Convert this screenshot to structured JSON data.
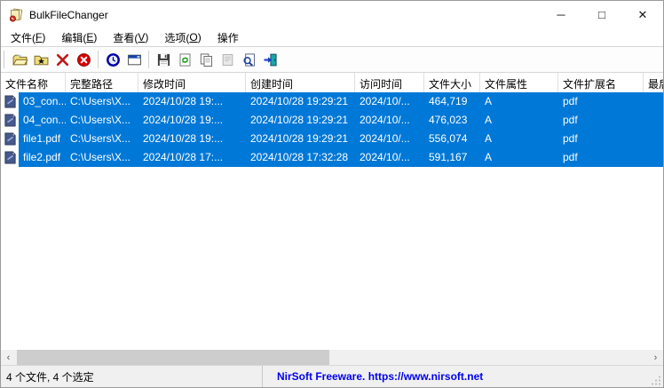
{
  "titlebar": {
    "title": "BulkFileChanger",
    "minimize_glyph": "─",
    "maximize_glyph": "□",
    "close_glyph": "✕"
  },
  "menu": {
    "items": [
      {
        "label": "文件(F)"
      },
      {
        "label": "编辑(E)"
      },
      {
        "label": "查看(V)"
      },
      {
        "label": "选项(O)"
      },
      {
        "label": "操作"
      }
    ]
  },
  "toolbar": {
    "icons": [
      "open-folder",
      "add-folder-wildcard",
      "delete-x",
      "clear-all",
      "change-time-clock",
      "properties-window",
      "save",
      "refresh",
      "copy",
      "file-properties-disabled",
      "find",
      "exit"
    ]
  },
  "table": {
    "columns": [
      "文件名称",
      "完整路径",
      "修改时间",
      "创建时间",
      "访问时间",
      "文件大小",
      "文件属性",
      "文件扩展名",
      "最后"
    ],
    "rows": [
      {
        "name": "03_con...",
        "path": "C:\\Users\\X...",
        "modified": "2024/10/28 19:...",
        "created": "2024/10/28 19:29:21",
        "accessed": "2024/10/...",
        "size": "464,719",
        "attr": "A",
        "ext": "pdf",
        "last": ""
      },
      {
        "name": "04_con...",
        "path": "C:\\Users\\X...",
        "modified": "2024/10/28 19:...",
        "created": "2024/10/28 19:29:21",
        "accessed": "2024/10/...",
        "size": "476,023",
        "attr": "A",
        "ext": "pdf",
        "last": ""
      },
      {
        "name": "file1.pdf",
        "path": "C:\\Users\\X...",
        "modified": "2024/10/28 19:...",
        "created": "2024/10/28 19:29:21",
        "accessed": "2024/10/...",
        "size": "556,074",
        "attr": "A",
        "ext": "pdf",
        "last": ""
      },
      {
        "name": "file2.pdf",
        "path": "C:\\Users\\X...",
        "modified": "2024/10/28 17:...",
        "created": "2024/10/28 17:32:28",
        "accessed": "2024/10/...",
        "size": "591,167",
        "attr": "A",
        "ext": "pdf",
        "last": ""
      }
    ],
    "all_selected": true
  },
  "statusbar": {
    "left": "4 个文件, 4 个选定",
    "link": "NirSoft Freeware. https://www.nirsoft.net"
  },
  "colors": {
    "selection": "#0078d7",
    "link": "#0000ee"
  }
}
